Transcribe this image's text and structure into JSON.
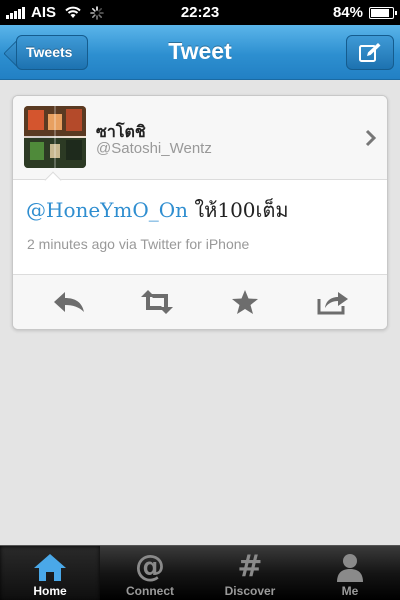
{
  "status_bar": {
    "carrier": "AIS",
    "time": "22:23",
    "battery": "84%",
    "battery_level": 0.84
  },
  "nav": {
    "back_label": "Tweets",
    "title": "Tweet",
    "compose_icon": "compose-icon"
  },
  "tweet": {
    "display_name": "ซาโตชิ",
    "handle": "@Satoshi_Wentz",
    "mention": "@HoneYmO_On",
    "body": " ให้100เต็ม",
    "meta": "2 minutes ago via Twitter for iPhone"
  },
  "actions": [
    {
      "icon": "reply-icon"
    },
    {
      "icon": "retweet-icon"
    },
    {
      "icon": "favorite-icon"
    },
    {
      "icon": "share-icon"
    }
  ],
  "tabs": [
    {
      "label": "Home",
      "icon": "home-icon",
      "active": true
    },
    {
      "label": "Connect",
      "icon": "at-icon",
      "active": false
    },
    {
      "label": "Discover",
      "icon": "hash-icon",
      "active": false
    },
    {
      "label": "Me",
      "icon": "person-icon",
      "active": false
    }
  ],
  "colors": {
    "nav_blue": "#2d8fd0",
    "mention_blue": "#2f8ed0",
    "home_icon_blue": "#4aa8e8"
  }
}
